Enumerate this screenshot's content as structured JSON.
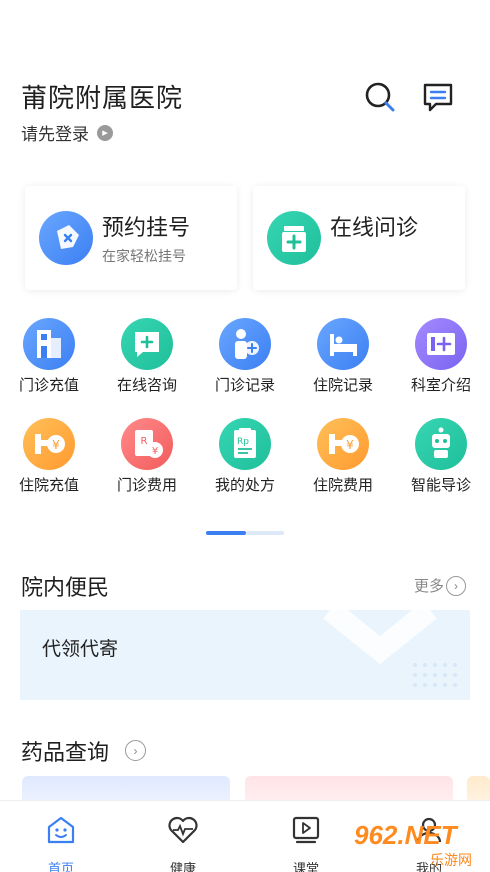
{
  "header": {
    "hospital_name": "莆院附属医院",
    "login_text": "请先登录"
  },
  "quick_cards": [
    {
      "title": "预约挂号",
      "subtitle": "在家轻松挂号",
      "icon": "tag-x-icon"
    },
    {
      "title": "在线问诊",
      "subtitle": "",
      "icon": "medicine-box-icon"
    }
  ],
  "grid": [
    {
      "label": "门诊充值",
      "icon": "building-icon",
      "color": "#3b7ff2"
    },
    {
      "label": "在线咨询",
      "icon": "chat-plus-icon",
      "color": "#1fbf9a"
    },
    {
      "label": "门诊记录",
      "icon": "doctor-icon",
      "color": "#3b7ff2"
    },
    {
      "label": "住院记录",
      "icon": "bed-icon",
      "color": "#3b7ff2"
    },
    {
      "label": "科室介绍",
      "icon": "clinic-icon",
      "color": "#7a63f0"
    },
    {
      "label": "住院充值",
      "icon": "wallet-yen-icon",
      "color": "#ff9a2e"
    },
    {
      "label": "门诊费用",
      "icon": "prescription-yen-icon",
      "color": "#f25c5c"
    },
    {
      "label": "我的处方",
      "icon": "rp-icon",
      "color": "#1fbf9a"
    },
    {
      "label": "住院费用",
      "icon": "wallet-yen-icon",
      "color": "#ff9a2e"
    },
    {
      "label": "智能导诊",
      "icon": "robot-icon",
      "color": "#1fbf9a"
    }
  ],
  "section_services": {
    "title": "院内便民",
    "more": "更多",
    "banner": "代领代寄"
  },
  "section_drugs": {
    "title": "药品查询"
  },
  "tabbar": [
    {
      "label": "首页",
      "icon": "home-smile-icon",
      "active": true
    },
    {
      "label": "健康",
      "icon": "heart-pulse-icon",
      "active": false
    },
    {
      "label": "课堂",
      "icon": "video-class-icon",
      "active": false
    },
    {
      "label": "我的",
      "icon": "user-icon",
      "active": false
    }
  ],
  "watermark": {
    "brand": "962.NET",
    "text": "乐游网"
  },
  "colors": {
    "accent": "#3b7ff2",
    "green": "#1fbf9a",
    "orange": "#ff9a2e",
    "red": "#f25c5c",
    "purple": "#7a63f0",
    "banner_bg": "#e9f4fd"
  }
}
